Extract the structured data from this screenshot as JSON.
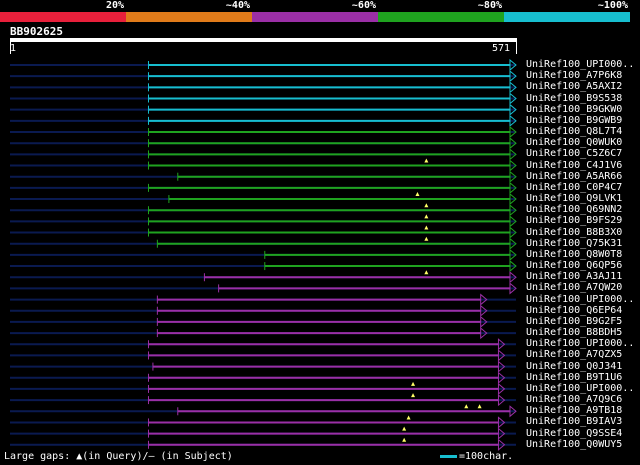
{
  "legend": {
    "segments": [
      {
        "label": "20%",
        "color": "#e8203b"
      },
      {
        "label": "~40%",
        "color": "#e07b1a"
      },
      {
        "label": "~60%",
        "color": "#9b2fa6"
      },
      {
        "label": "~80%",
        "color": "#1fa31f"
      },
      {
        "label": "~100%",
        "color": "#17becf"
      }
    ]
  },
  "query": {
    "id": "BB902625",
    "start": "1",
    "end": "571"
  },
  "hits": [
    {
      "label": "UniRef100_UPI000..",
      "start": 157,
      "end": 571,
      "color": "#17becf",
      "arrow": "up",
      "query_gaps": []
    },
    {
      "label": "UniRef100_A7P6K8",
      "start": 157,
      "end": 571,
      "color": "#17becf",
      "query_gaps": []
    },
    {
      "label": "UniRef100_A5AXI2",
      "start": 157,
      "end": 571,
      "color": "#17becf",
      "query_gaps": []
    },
    {
      "label": "UniRef100_B9S538",
      "start": 157,
      "end": 571,
      "color": "#17becf",
      "query_gaps": []
    },
    {
      "label": "UniRef100_B9GKW0",
      "start": 157,
      "end": 571,
      "color": "#17becf",
      "query_gaps": []
    },
    {
      "label": "UniRef100_B9GWB9",
      "start": 157,
      "end": 571,
      "color": "#17becf",
      "query_gaps": []
    },
    {
      "label": "UniRef100_Q8L7T4",
      "start": 157,
      "end": 571,
      "color": "#1fa31f",
      "query_gaps": []
    },
    {
      "label": "UniRef100_Q0WUK0",
      "start": 157,
      "end": 571,
      "color": "#1fa31f",
      "query_gaps": []
    },
    {
      "label": "UniRef100_C5Z6C7",
      "start": 157,
      "end": 571,
      "color": "#1fa31f",
      "query_gaps": []
    },
    {
      "label": "UniRef100_C4J1V6",
      "start": 157,
      "end": 571,
      "color": "#1fa31f",
      "query_gaps": [
        470
      ]
    },
    {
      "label": "UniRef100_A5AR66",
      "start": 190,
      "end": 571,
      "color": "#1fa31f",
      "query_gaps": []
    },
    {
      "label": "UniRef100_C0P4C7",
      "start": 157,
      "end": 571,
      "color": "#1fa31f",
      "query_gaps": []
    },
    {
      "label": "UniRef100_Q9LVK1",
      "start": 180,
      "end": 571,
      "color": "#1fa31f",
      "query_gaps": [
        460
      ]
    },
    {
      "label": "UniRef100_Q69NN2",
      "start": 157,
      "end": 571,
      "color": "#1fa31f",
      "query_gaps": [
        470
      ]
    },
    {
      "label": "UniRef100_B9FS29",
      "start": 157,
      "end": 571,
      "color": "#1fa31f",
      "query_gaps": [
        470
      ]
    },
    {
      "label": "UniRef100_B8B3X0",
      "start": 157,
      "end": 571,
      "color": "#1fa31f",
      "query_gaps": [
        470
      ]
    },
    {
      "label": "UniRef100_Q75K31",
      "start": 167,
      "end": 571,
      "color": "#1fa31f",
      "query_gaps": [
        470
      ]
    },
    {
      "label": "UniRef100_Q8W0T8",
      "start": 288,
      "end": 571,
      "color": "#1fa31f",
      "query_gaps": []
    },
    {
      "label": "UniRef100_Q6QP56",
      "start": 288,
      "end": 571,
      "color": "#1fa31f",
      "query_gaps": []
    },
    {
      "label": "UniRef100_A3AJ11",
      "start": 220,
      "end": 571,
      "color": "#9b2fa6",
      "query_gaps": [
        470
      ]
    },
    {
      "label": "UniRef100_A7QW20",
      "start": 236,
      "end": 571,
      "color": "#9b2fa6",
      "query_gaps": []
    },
    {
      "label": "UniRef100_UPI000..",
      "start": 167,
      "end": 538,
      "color": "#9b2fa6",
      "query_gaps": []
    },
    {
      "label": "UniRef100_Q6EP64",
      "start": 167,
      "end": 538,
      "color": "#9b2fa6",
      "query_gaps": []
    },
    {
      "label": "UniRef100_B9G2F5",
      "start": 167,
      "end": 538,
      "color": "#9b2fa6",
      "query_gaps": []
    },
    {
      "label": "UniRef100_B8BDH5",
      "start": 167,
      "end": 538,
      "color": "#9b2fa6",
      "query_gaps": []
    },
    {
      "label": "UniRef100_UPI000..",
      "start": 157,
      "end": 558,
      "color": "#9b2fa6",
      "query_gaps": []
    },
    {
      "label": "UniRef100_A7QZX5",
      "start": 157,
      "end": 558,
      "color": "#9b2fa6",
      "query_gaps": []
    },
    {
      "label": "UniRef100_Q0J341",
      "start": 162,
      "end": 558,
      "color": "#9b2fa6",
      "query_gaps": []
    },
    {
      "label": "UniRef100_B9T1U6",
      "start": 157,
      "end": 558,
      "color": "#9b2fa6",
      "query_gaps": []
    },
    {
      "label": "UniRef100_UPI000..",
      "start": 157,
      "end": 558,
      "color": "#9b2fa6",
      "query_gaps": [
        455
      ]
    },
    {
      "label": "UniRef100_A7Q9C6",
      "start": 157,
      "end": 558,
      "color": "#9b2fa6",
      "query_gaps": [
        455
      ]
    },
    {
      "label": "UniRef100_A9TB18",
      "start": 190,
      "end": 571,
      "color": "#9b2fa6",
      "query_gaps": [
        515,
        530
      ]
    },
    {
      "label": "UniRef100_B9IAV3",
      "start": 157,
      "end": 558,
      "color": "#9b2fa6",
      "query_gaps": [
        450
      ]
    },
    {
      "label": "UniRef100_Q9SSE4",
      "start": 157,
      "end": 558,
      "color": "#9b2fa6",
      "query_gaps": [
        445
      ]
    },
    {
      "label": "UniRef100_Q0WUY5",
      "start": 157,
      "end": 558,
      "color": "#9b2fa6",
      "query_gaps": [
        445
      ]
    }
  ],
  "footer": {
    "gaps_text": "Large gaps: ▲(in Query)/– (in Subject)",
    "scale_text": "=100char.",
    "scale_color": "#17becf"
  }
}
